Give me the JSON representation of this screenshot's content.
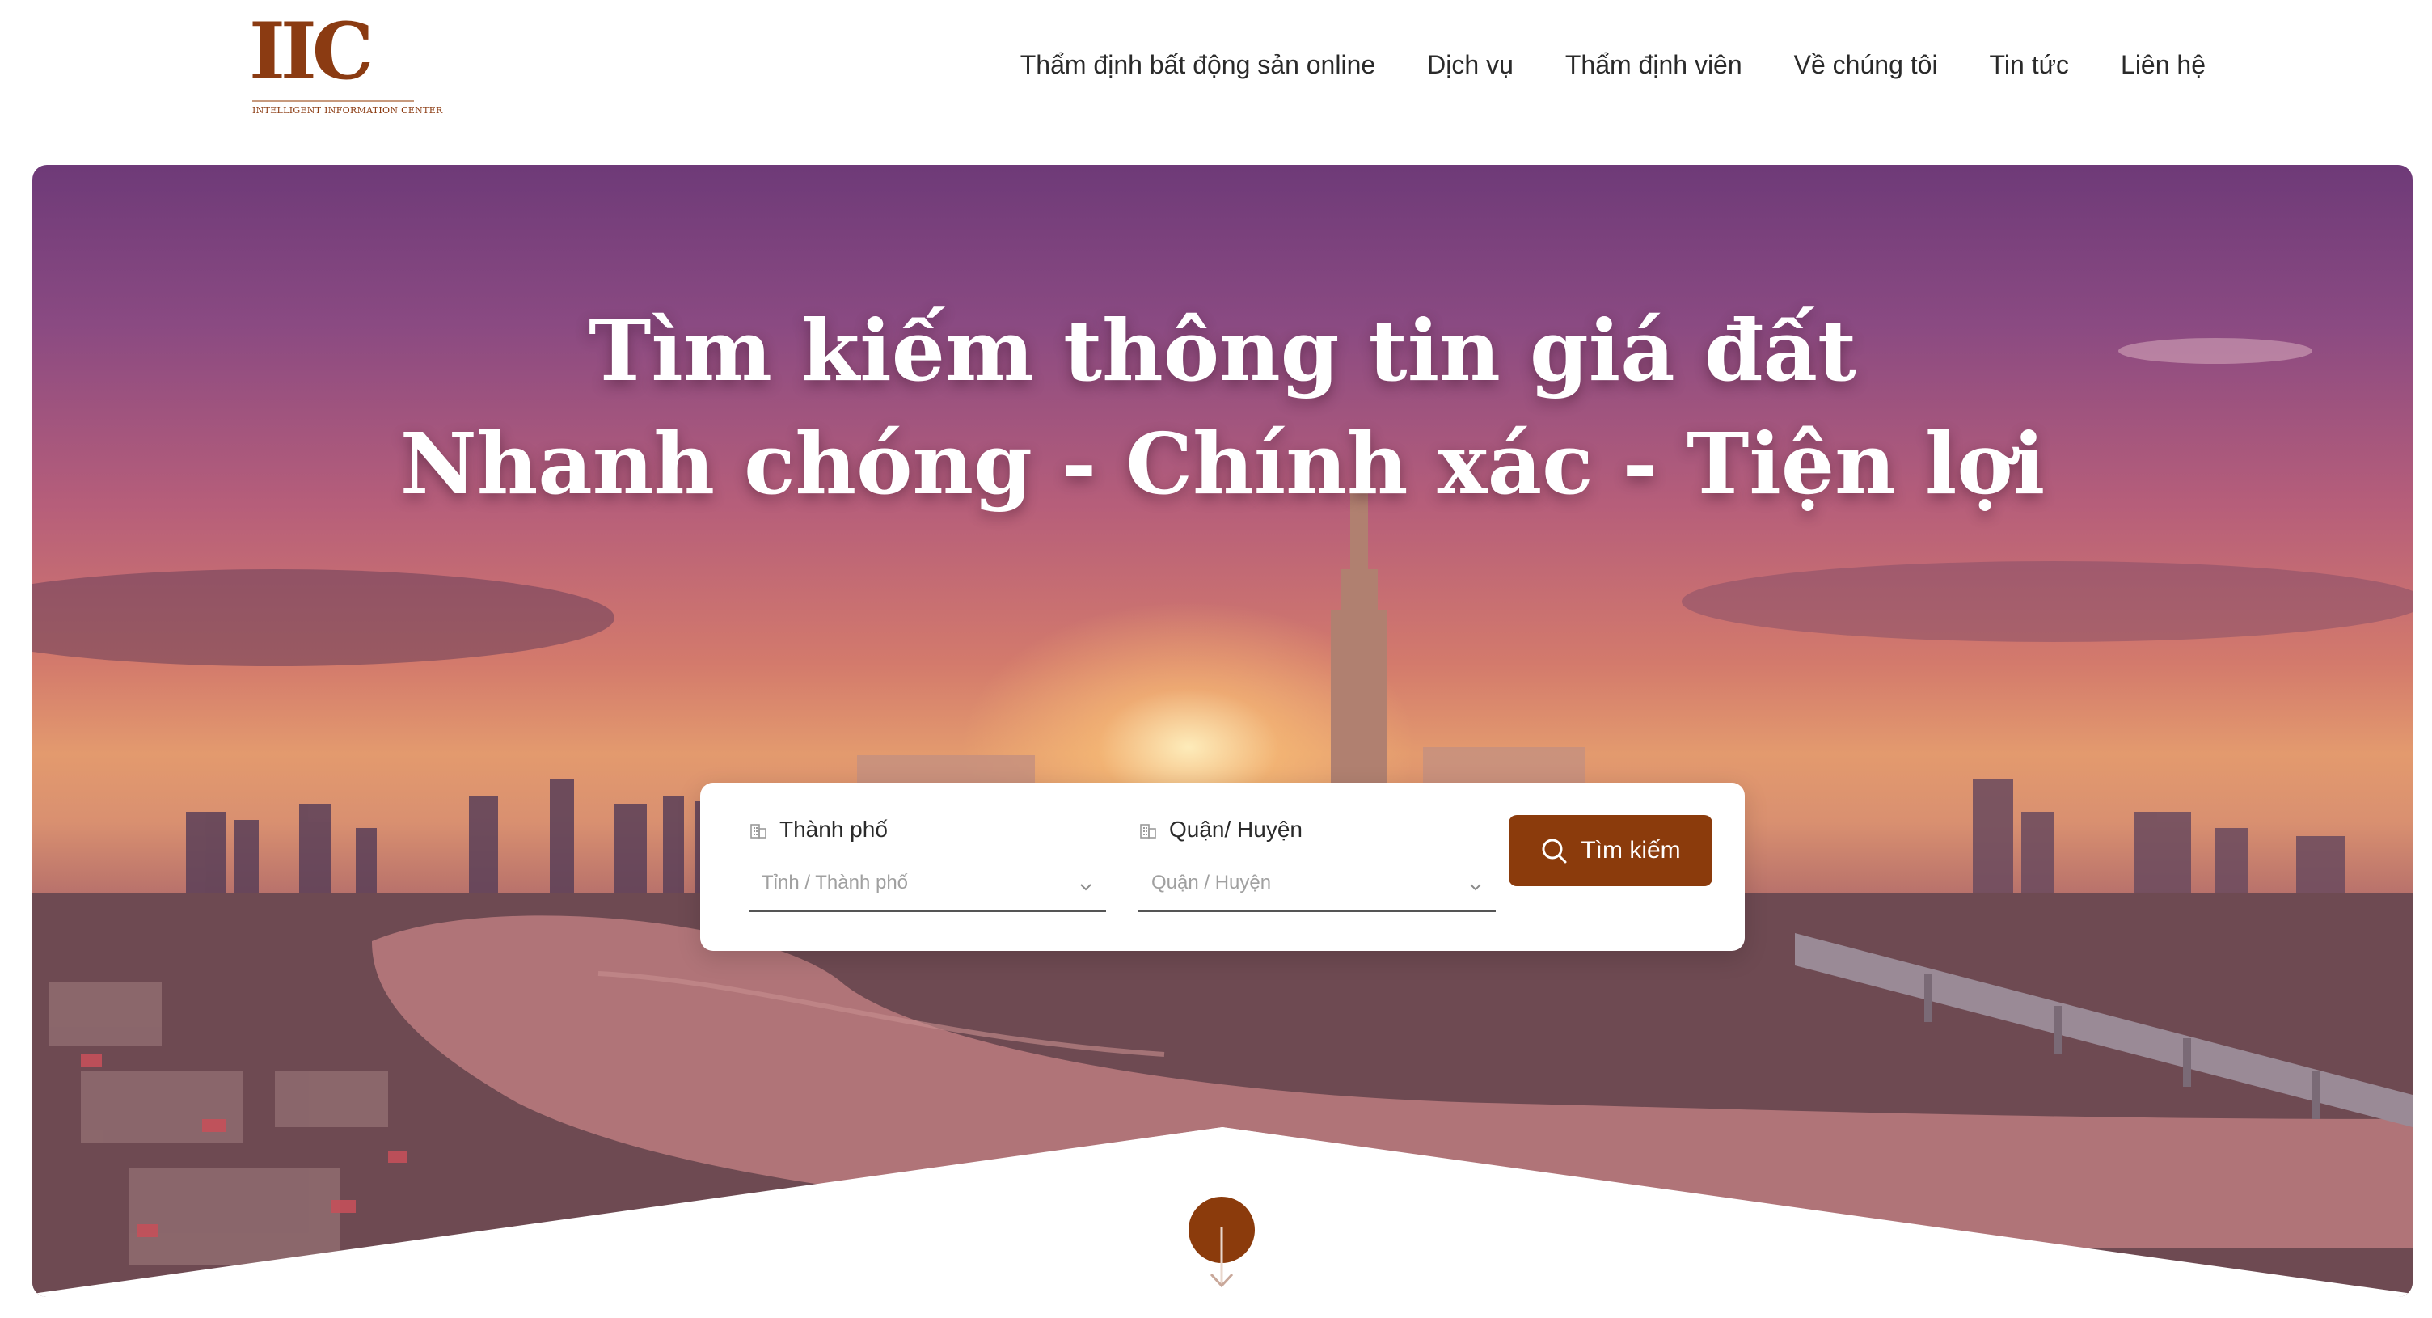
{
  "brand": {
    "logo_mark": "IIC",
    "logo_subtitle": "INTELLIGENT INFORMATION CENTER",
    "colors": {
      "primary": "#8b3b0c",
      "text": "#2a2a2a",
      "placeholder": "#a0a0a0"
    }
  },
  "nav": {
    "items": [
      {
        "label": "Thẩm định bất động sản online"
      },
      {
        "label": "Dịch vụ"
      },
      {
        "label": "Thẩm định viên"
      },
      {
        "label": "Về chúng tôi"
      },
      {
        "label": "Tin tức"
      },
      {
        "label": "Liên hệ"
      }
    ]
  },
  "hero": {
    "title_line1": "Tìm kiếm thông tin giá đất",
    "title_line2": "Nhanh chóng - Chính xác - Tiện lợi"
  },
  "search": {
    "city": {
      "label": "Thành phố",
      "placeholder": "Tỉnh / Thành phố",
      "icon": "building-icon"
    },
    "district": {
      "label": "Quận/ Huyện",
      "placeholder": "Quận / Huyện",
      "icon": "building-icon"
    },
    "button_label": "Tìm kiếm",
    "button_icon": "search-icon"
  },
  "scroll": {
    "icon": "arrow-down-icon"
  }
}
